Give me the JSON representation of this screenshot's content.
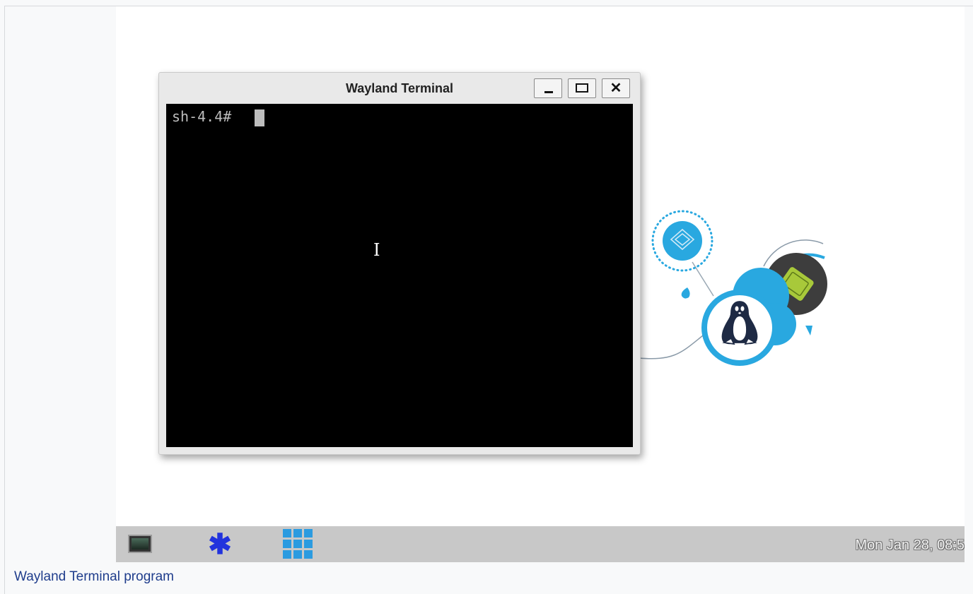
{
  "window": {
    "title": "Wayland Terminal",
    "buttons": {
      "minimize": "_",
      "maximize": "□",
      "close": "✕"
    }
  },
  "terminal": {
    "prompt": "sh-4.4#"
  },
  "taskbar": {
    "launchers": [
      "terminal-icon",
      "asterisk-icon",
      "app-grid-icon"
    ],
    "clock": "Mon Jan 28, 08:5"
  },
  "caption": "Wayland Terminal program",
  "colors": {
    "taskbar_bg": "#c8c8c8",
    "terminal_bg": "#000000",
    "accent_blue": "#29a8e0",
    "chip_green": "#a8c93a",
    "caption_link": "#1f3d8c"
  }
}
